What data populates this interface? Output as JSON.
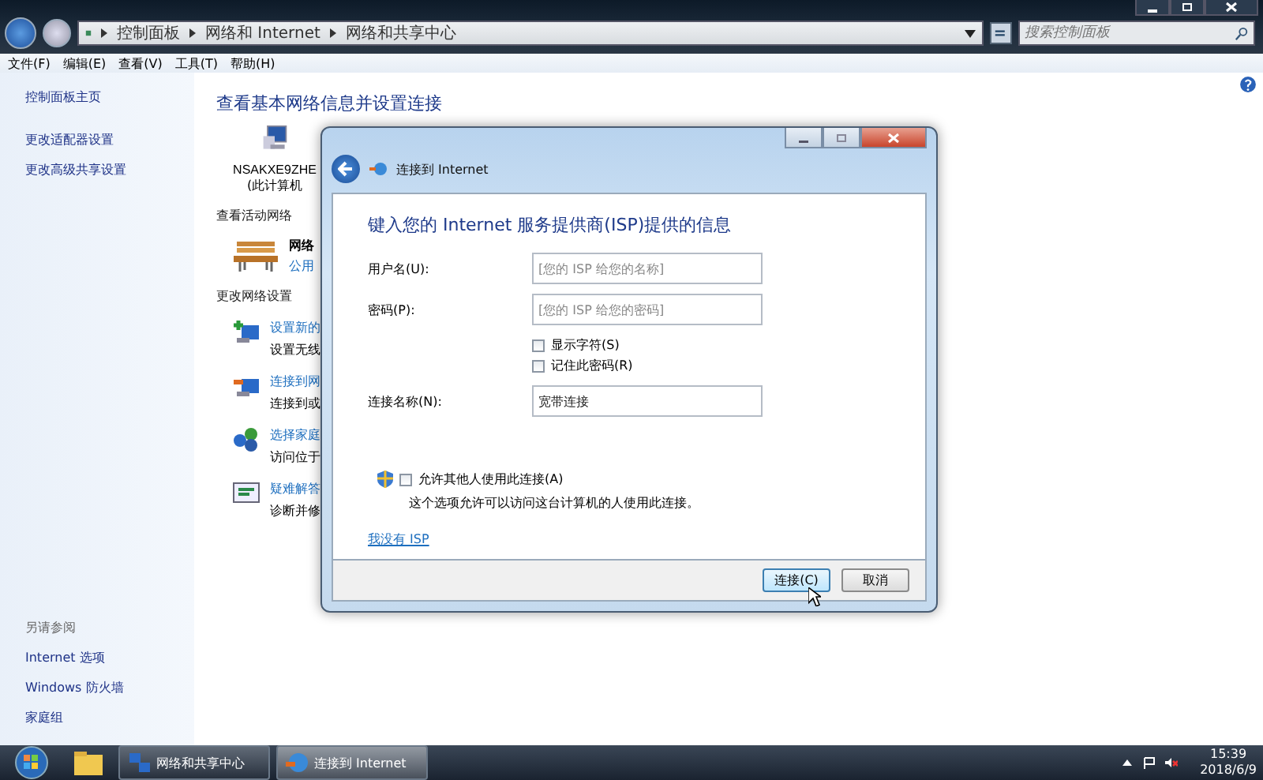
{
  "window": {
    "breadcrumb": [
      "控制面板",
      "网络和 Internet",
      "网络和共享中心"
    ],
    "search": {
      "placeholder": "搜索控制面板"
    }
  },
  "menu": [
    "文件(F)",
    "编辑(E)",
    "查看(V)",
    "工具(T)",
    "帮助(H)"
  ],
  "sidebar": {
    "items": [
      "控制面板主页",
      "更改适配器设置",
      "更改高级共享设置"
    ],
    "see_also": {
      "title": "另请参阅",
      "items": [
        "Internet 选项",
        "Windows 防火墙",
        "家庭组"
      ]
    }
  },
  "main": {
    "title": "查看基本网络信息并设置连接",
    "computer": {
      "name": "NSAKXE9ZHE",
      "note": "(此计算机"
    },
    "active_networks": {
      "heading": "查看活动网络",
      "network": {
        "name": "网络",
        "type": "公用"
      }
    },
    "settings": {
      "heading": "更改网络设置",
      "tasks": [
        {
          "kind": "setup",
          "link": "设置新的",
          "description": "设置无线"
        },
        {
          "kind": "connect",
          "link": "连接到网",
          "description": "连接到或"
        },
        {
          "kind": "homegroup",
          "link": "选择家庭",
          "description": "访问位于"
        },
        {
          "kind": "troubleshoot",
          "link": "疑难解答",
          "description": "诊断并修"
        }
      ]
    }
  },
  "dialog": {
    "title": "连接到 Internet",
    "heading": "键入您的 Internet 服务提供商(ISP)提供的信息",
    "fields": [
      {
        "label": "用户名(U):",
        "placeholder": "[您的 ISP 给您的名称]"
      },
      {
        "label": "密码(P):",
        "placeholder": "[您的 ISP 给您的密码]"
      }
    ],
    "options": [
      {
        "label": "显示字符(S)",
        "checked": false
      },
      {
        "label": "记住此密码(R)",
        "checked": false
      }
    ],
    "connection_name": {
      "label": "连接名称(N):",
      "value": "宽带连接"
    },
    "allow_others": {
      "label": "允许其他人使用此连接(A)",
      "checked": false,
      "description": "这个选项允许可以访问这台计算机的人使用此连接。"
    },
    "link": "我没有 ISP",
    "buttons": [
      {
        "label": "连接(C)",
        "default": true
      },
      {
        "label": "取消",
        "default": false
      }
    ]
  },
  "taskbar": {
    "items": [
      {
        "label": "网络和共享中心",
        "selected": false
      },
      {
        "label": "连接到 Internet",
        "selected": true
      }
    ],
    "time": "15:39",
    "date": "2018/6/9"
  }
}
